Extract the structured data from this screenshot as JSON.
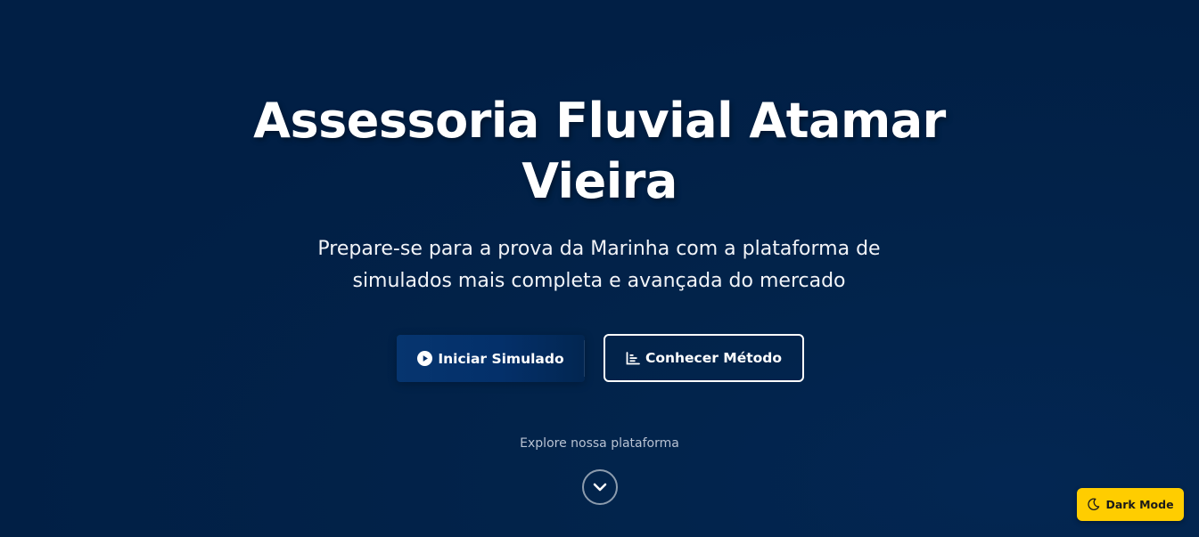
{
  "hero": {
    "title_line1": "Assessoria Fluvial Atamar",
    "title_line2": "Vieira",
    "subtitle_line1": "Prepare-se para a prova da Marinha com a plataforma de",
    "subtitle_line2": "simulados mais completa e avançada do mercado"
  },
  "actions": {
    "primary_label": "Iniciar Simulado",
    "primary_icon": "play-circle-icon",
    "secondary_label": "Conhecer Método",
    "secondary_icon": "bar-chart-icon"
  },
  "explore": {
    "label": "Explore nossa plataforma",
    "icon": "chevron-down-icon"
  },
  "theme_toggle": {
    "label": "Dark Mode",
    "icon": "moon-icon"
  },
  "colors": {
    "background": "#011f45",
    "accent_yellow": "#ffcd00",
    "primary_button": "#04306a",
    "text": "#ffffff"
  }
}
